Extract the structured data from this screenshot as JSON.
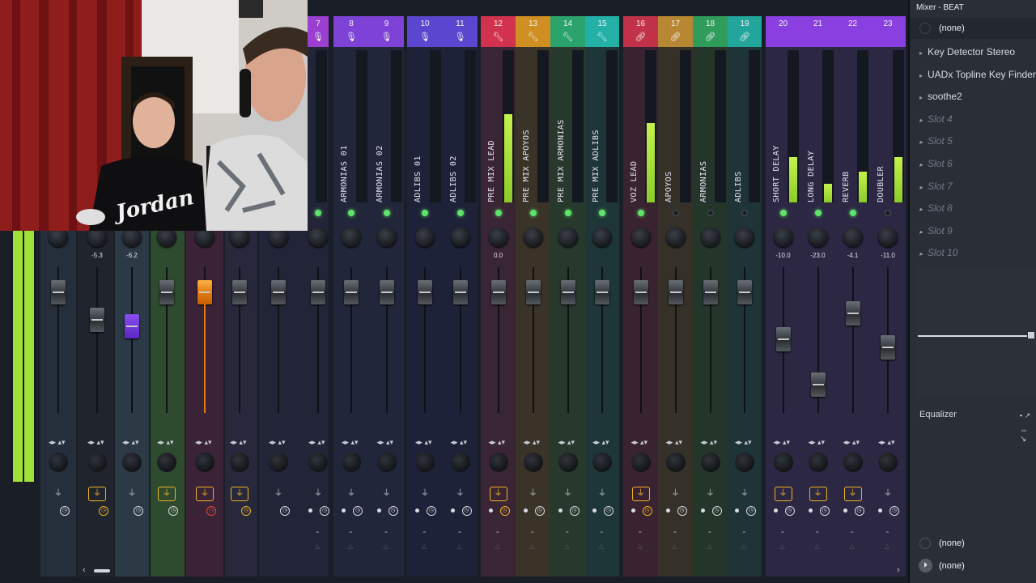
{
  "window": {
    "title": "Mixer - BEAT"
  },
  "colors": {
    "meter": "#a6e43a",
    "active_led": "#5fe36a",
    "routing_active": "#f0b425",
    "purple": "#7f43d6",
    "red": "#d1324d",
    "green": "#2aa46c",
    "teal": "#23b1a7"
  },
  "strips": [
    {
      "number": "7",
      "icon": "mic-icon",
      "name": "",
      "volume": ""
    },
    {
      "number": "8",
      "icon": "mic-icon",
      "name": "ARMONIAS 01",
      "volume": ""
    },
    {
      "number": "9",
      "icon": "mic-icon",
      "name": "ARMONIAS 02",
      "volume": ""
    },
    {
      "number": "10",
      "icon": "mic-icon",
      "name": "ADLIBS 01",
      "volume": ""
    },
    {
      "number": "11",
      "icon": "mic-icon",
      "name": "ADLIBS 02",
      "volume": ""
    },
    {
      "number": "12",
      "icon": "wrench-icon",
      "name": "PRE MIX LEAD",
      "volume": "0.0"
    },
    {
      "number": "13",
      "icon": "wrench-icon",
      "name": "PRE MIX APOYOS",
      "volume": ""
    },
    {
      "number": "14",
      "icon": "wrench-icon",
      "name": "PRE MIX ARMONIAS",
      "volume": ""
    },
    {
      "number": "15",
      "icon": "wrench-icon",
      "name": "PRE MIX ADLIBS",
      "volume": ""
    },
    {
      "number": "16",
      "icon": "link-icon",
      "name": "VOZ LEAD",
      "volume": ""
    },
    {
      "number": "17",
      "icon": "link-icon",
      "name": "APOYOS",
      "volume": ""
    },
    {
      "number": "18",
      "icon": "link-icon",
      "name": "ARMONIAS",
      "volume": ""
    },
    {
      "number": "19",
      "icon": "link-icon",
      "name": "ADLIBS",
      "volume": ""
    },
    {
      "number": "20",
      "icon": "",
      "name": "SHORT DELAY",
      "volume": "-10.0"
    },
    {
      "number": "21",
      "icon": "",
      "name": "LONG DELAY",
      "volume": "-23.0"
    },
    {
      "number": "22",
      "icon": "",
      "name": "REVERB",
      "volume": "-4.1"
    },
    {
      "number": "23",
      "icon": "",
      "name": "DOUBLER",
      "volume": "-11.0"
    }
  ],
  "left_strips": {
    "volumes": [
      "-5.3",
      "-6.2"
    ]
  },
  "panel": {
    "preset": "(none)",
    "slots": [
      {
        "label": "Key Detector Stereo",
        "empty": false
      },
      {
        "label": "UADx Topline Key Finder",
        "empty": false
      },
      {
        "label": "soothe2",
        "empty": false
      },
      {
        "label": "Slot 4",
        "empty": true
      },
      {
        "label": "Slot 5",
        "empty": true
      },
      {
        "label": "Slot 6",
        "empty": true
      },
      {
        "label": "Slot 7",
        "empty": true
      },
      {
        "label": "Slot 8",
        "empty": true
      },
      {
        "label": "Slot 9",
        "empty": true
      },
      {
        "label": "Slot 10",
        "empty": true
      }
    ],
    "eq_label": "Equalizer",
    "input": "(none)",
    "output": "(none)"
  },
  "webcam": {
    "shirt_text": "Jordan"
  }
}
